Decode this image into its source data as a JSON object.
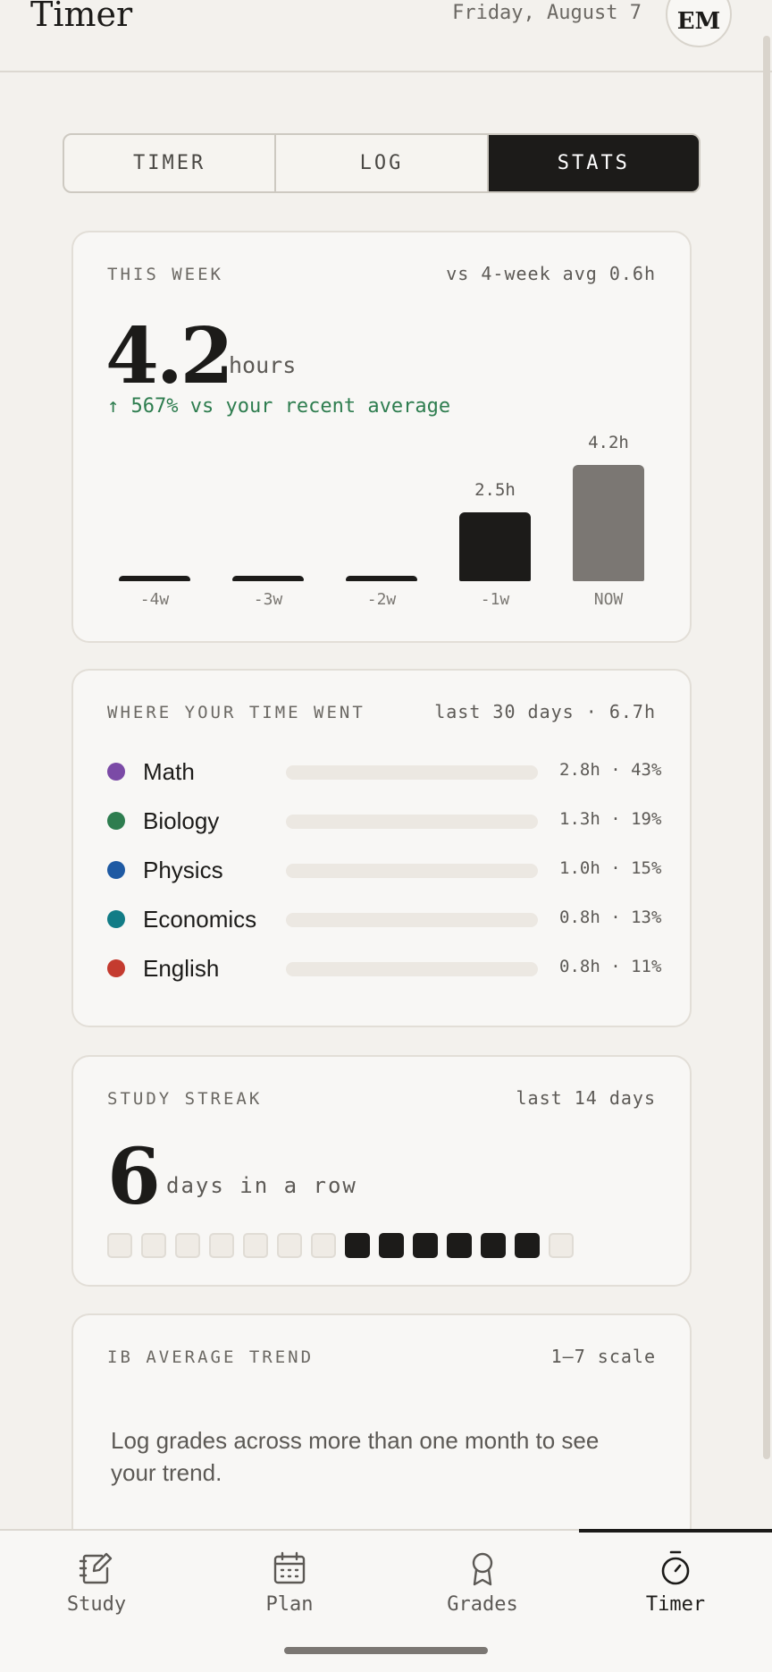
{
  "header": {
    "title": "Timer",
    "date": "Friday, August 7",
    "avatar_initials": "EM"
  },
  "tabs": [
    {
      "label": "TIMER",
      "active": false
    },
    {
      "label": "LOG",
      "active": false
    },
    {
      "label": "STATS",
      "active": true
    }
  ],
  "week_card": {
    "label": "THIS WEEK",
    "meta": "vs 4-week avg 0.6h",
    "value": "4.2",
    "unit": "hours",
    "delta": "↑ 567% vs your recent average",
    "delta_color": "#2e7d4f"
  },
  "chart_data": {
    "type": "bar",
    "categories": [
      "-4w",
      "-3w",
      "-2w",
      "-1w",
      "NOW"
    ],
    "values": [
      0.0,
      0.0,
      0.0,
      2.5,
      4.2
    ],
    "value_labels": [
      "",
      "",
      "",
      "2.5h",
      "4.2h"
    ],
    "ylim": [
      0,
      4.2
    ],
    "colors": [
      "#1c1b19",
      "#1c1b19",
      "#1c1b19",
      "#1c1b19",
      "#7b7773"
    ]
  },
  "where_card": {
    "label": "WHERE YOUR TIME WENT",
    "meta": "last 30 days · 6.7h",
    "subjects": [
      {
        "name": "Math",
        "stat": "2.8h · 43%",
        "color": "#7b4aa6"
      },
      {
        "name": "Biology",
        "stat": "1.3h · 19%",
        "color": "#2e7d4f"
      },
      {
        "name": "Physics",
        "stat": "1.0h · 15%",
        "color": "#1f5aa3"
      },
      {
        "name": "Economics",
        "stat": "0.8h · 13%",
        "color": "#127c86"
      },
      {
        "name": "English",
        "stat": "0.8h · 11%",
        "color": "#c43b2f"
      }
    ]
  },
  "streak_card": {
    "label": "STUDY STREAK",
    "meta": "last 14 days",
    "value": "6",
    "unit": "days in a row",
    "days": [
      false,
      false,
      false,
      false,
      false,
      false,
      false,
      true,
      true,
      true,
      true,
      true,
      true,
      false
    ]
  },
  "ib_card": {
    "label": "IB AVERAGE TREND",
    "meta": "1–7 scale",
    "message": "Log grades across more than one month to see your trend."
  },
  "bottom_nav": [
    {
      "label": "Study",
      "icon": "notebook-pencil-icon",
      "active": false
    },
    {
      "label": "Plan",
      "icon": "calendar-icon",
      "active": false
    },
    {
      "label": "Grades",
      "icon": "award-ribbon-icon",
      "active": false
    },
    {
      "label": "Timer",
      "icon": "stopwatch-icon",
      "active": true
    }
  ]
}
